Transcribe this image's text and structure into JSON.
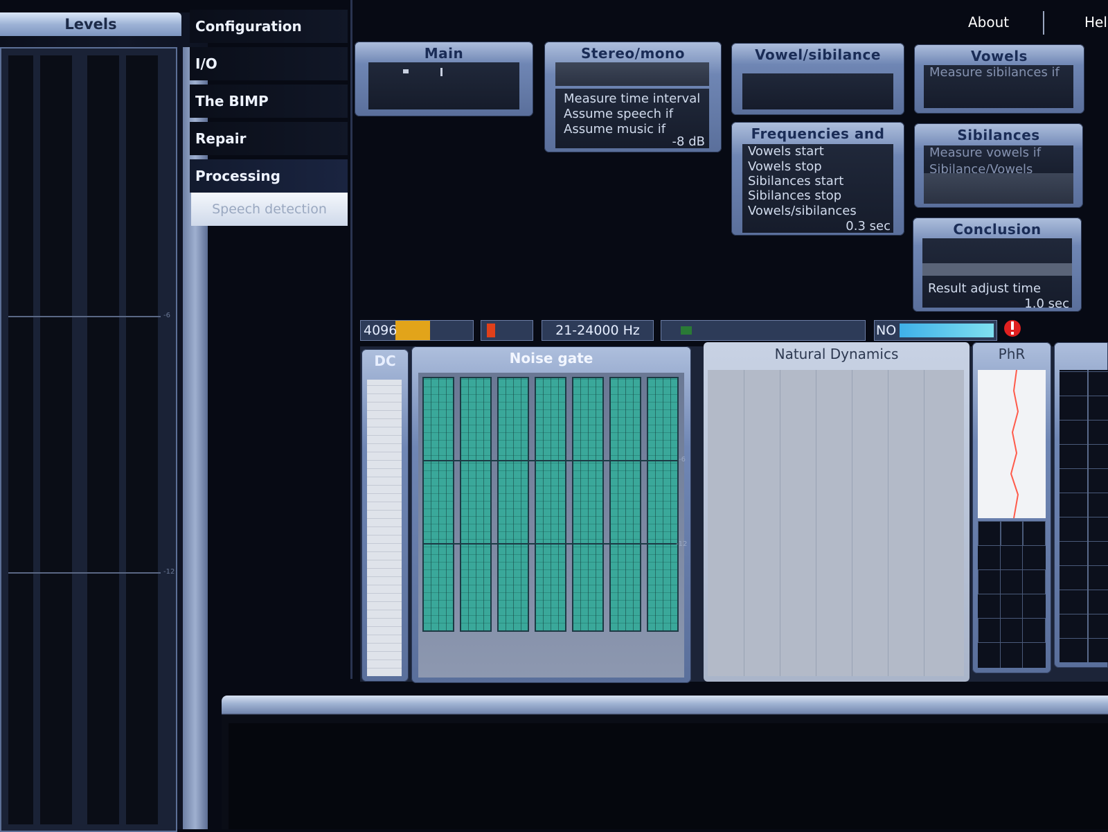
{
  "levels": {
    "title": "Levels",
    "ticks": [
      "-6",
      "-12"
    ]
  },
  "nav": {
    "items": [
      {
        "label": "Configuration"
      },
      {
        "label": "I/O"
      },
      {
        "label": "The BIMP"
      },
      {
        "label": "Repair"
      },
      {
        "label": "Processing"
      }
    ],
    "active_sub": "Speech detection"
  },
  "header": {
    "about": "About",
    "help": "Help"
  },
  "panels": {
    "main": {
      "title": "Main"
    },
    "stereo_mono": {
      "title": "Stereo/mono",
      "lines": [
        "Measure time interval",
        "Assume speech if",
        "Assume music if"
      ],
      "value": "-8 dB"
    },
    "vowel_sibilance": {
      "title": "Vowel/sibilance"
    },
    "vowels": {
      "title": "Vowels",
      "line": "Measure sibilances if"
    },
    "frequencies": {
      "title": "Frequencies and",
      "lines": [
        "Vowels start",
        "Vowels stop",
        "Sibilances start",
        "Sibilances stop",
        "Vowels/sibilances"
      ],
      "value": "0.3 sec"
    },
    "sibilances": {
      "title": "Sibilances",
      "lines": [
        "Measure vowels if",
        "Sibilance/Vowels"
      ]
    },
    "conclusion": {
      "title": "Conclusion",
      "line": "Result adjust time",
      "value": "1.0 sec"
    }
  },
  "status": {
    "buffer": "4096",
    "buffer_fill": 0.45,
    "freq_range": "21-24000 Hz",
    "result": "NO",
    "colors": {
      "buffer": "#e2a41a",
      "red": "#e0401a",
      "result": "#3fb0e8",
      "alert": "#e02020"
    }
  },
  "modules": {
    "dc": {
      "title": "DC"
    },
    "noise_gate": {
      "title": "Noise gate",
      "ticks": [
        "-6",
        "-12"
      ],
      "color": "#3fb8a6"
    },
    "natural_dynamics": {
      "title": "Natural Dynamics"
    },
    "phr": {
      "title": "PhR",
      "trace_color": "#ff5a4a"
    }
  }
}
